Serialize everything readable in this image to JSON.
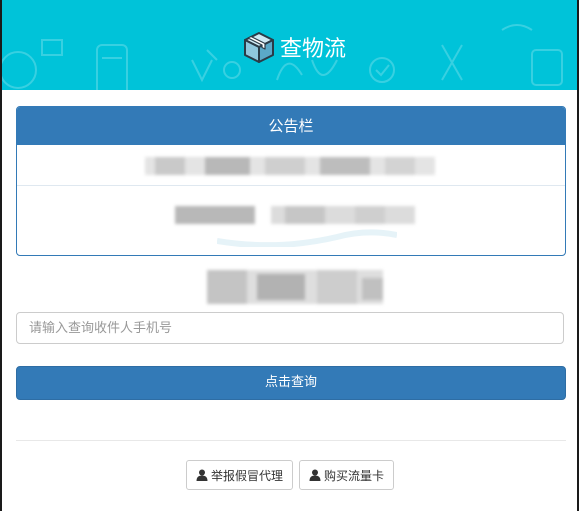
{
  "header": {
    "title": "查物流",
    "logo_icon": "package-box-icon",
    "bg_color": "#00c3d9"
  },
  "notice": {
    "heading": "公告栏",
    "accent": "#337ab7"
  },
  "search": {
    "placeholder": "请输入查询收件人手机号"
  },
  "query_button": {
    "label": "点击查询"
  },
  "footer_links": [
    {
      "label": "举报假冒代理",
      "icon": "user-icon"
    },
    {
      "label": "购买流量卡",
      "icon": "user-icon"
    }
  ]
}
